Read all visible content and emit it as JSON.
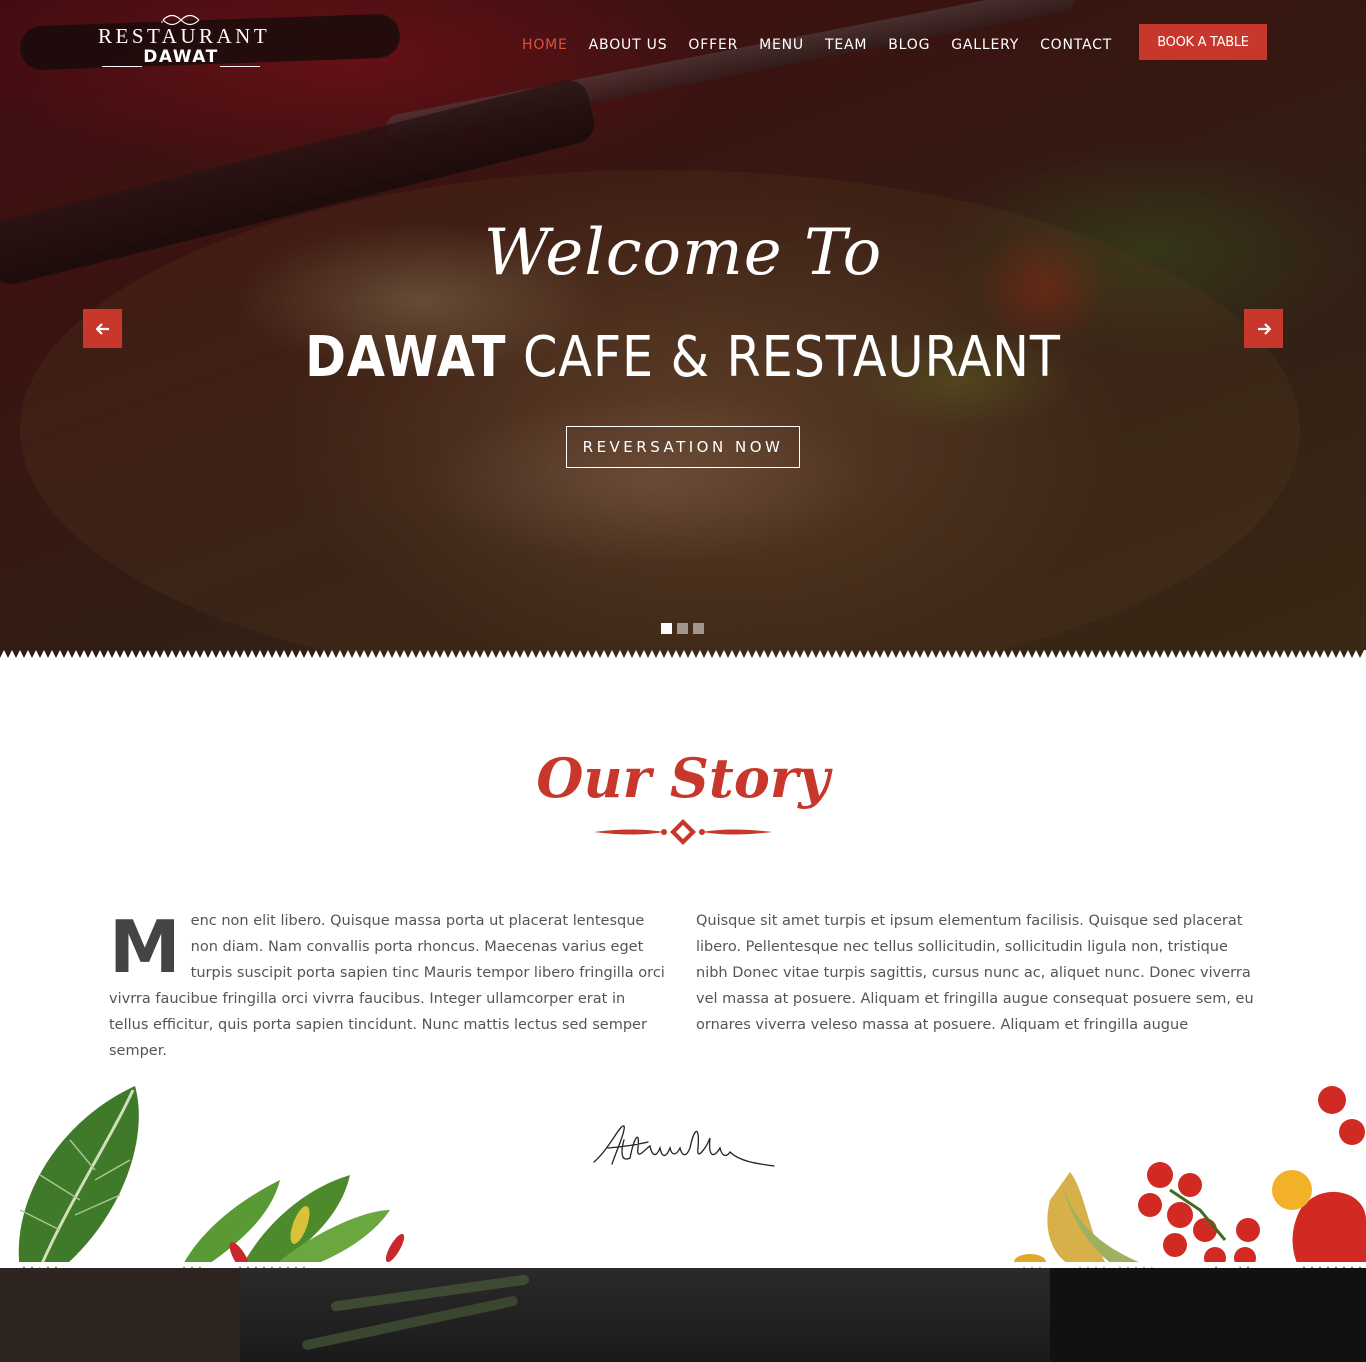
{
  "brand": {
    "logo_top": "RESTAURANT",
    "logo_bottom": "DAWAT"
  },
  "nav": {
    "items": [
      {
        "label": "HOME",
        "active": true
      },
      {
        "label": "ABOUT US"
      },
      {
        "label": "OFFER"
      },
      {
        "label": "MENU"
      },
      {
        "label": "TEAM"
      },
      {
        "label": "BLOG"
      },
      {
        "label": "GALLERY"
      },
      {
        "label": "CONTACT"
      }
    ],
    "book_label": "BOOK A TABLE"
  },
  "hero": {
    "script": "Welcome To",
    "title_bold": "DAWAT",
    "title_rest": " CAFE & RESTAURANT",
    "cta": "REVERSATION NOW",
    "prev_icon": "arrow-left-icon",
    "next_icon": "arrow-right-icon",
    "slides": 3,
    "active_slide": 1
  },
  "story": {
    "title": "Our Story",
    "dropcap": "M",
    "left_text": "enc non elit libero. Quisque massa porta ut placerat lentesque non diam. Nam convallis porta rhoncus. Maecenas varius eget turpis suscipit porta sapien tinc Mauris tempor libero fringilla orci vivrra faucibue fringilla orci vivrra faucibus. Integer ullamcorper erat in tellus efficitur, quis porta sapien tincidunt. Nunc mattis lectus sed semper semper.",
    "right_text": "Quisque sit amet turpis et ipsum elementum facilisis. Quisque sed placerat libero. Pellentesque nec tellus sollicitudin, sollicitudin ligula non, tristique nibh Donec vitae turpis sagittis, cursus nunc ac, aliquet nunc. Donec viverra vel massa at posuere. Aliquam et fringilla augue consequat posuere sem, eu ornares viverra veleso massa at posuere. Aliquam et fringilla augue"
  },
  "colors": {
    "accent": "#c8372b",
    "text": "#555555",
    "white": "#ffffff"
  }
}
